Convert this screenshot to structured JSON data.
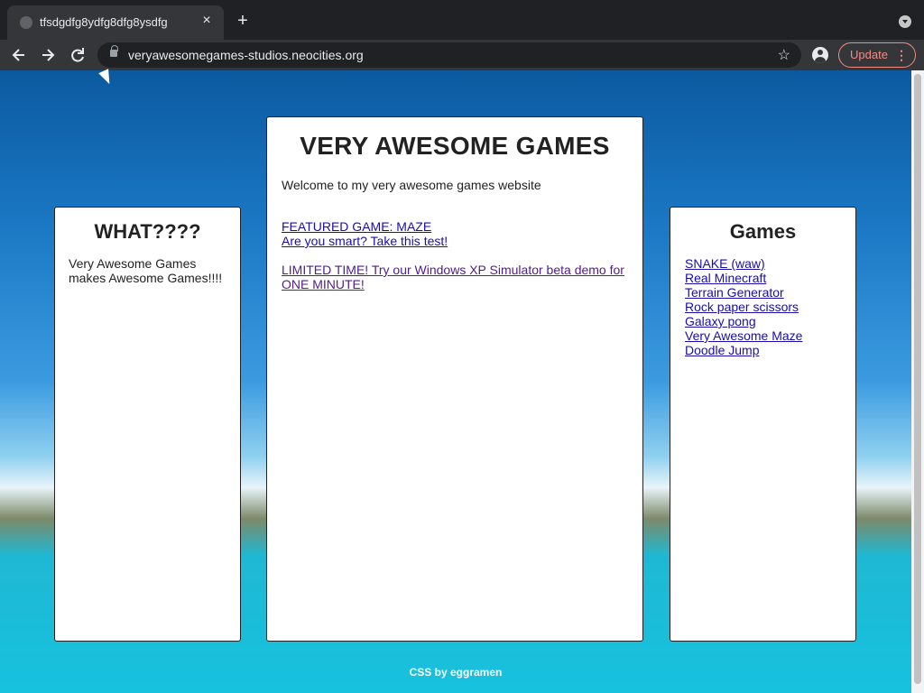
{
  "browser": {
    "tab": {
      "title": "tfsdgdfg8ydfg8dfg8ysdfg",
      "close_icon": "×"
    },
    "new_tab_icon": "+",
    "url": "veryawesomegames-studios.neocities.org",
    "update_label": "Update",
    "update_menu": "⋮"
  },
  "page": {
    "left": {
      "title": "WHAT????",
      "text": "Very Awesome Games makes Awesome Games!!!!"
    },
    "center": {
      "title": "VERY AWESOME GAMES",
      "welcome": "Welcome to my very awesome games website",
      "featured_link": "FEATURED GAME: MAZE",
      "test_link": "Are you smart? Take this test!",
      "xp_link": "LIMITED TIME! Try our Windows XP Simulator beta demo for ONE MINUTE!"
    },
    "right": {
      "title": "Games",
      "games": [
        "SNAKE (waw)",
        "Real Minecraft",
        "Terrain Generator",
        "Rock paper scissors",
        "Galaxy pong",
        "Very Awesome Maze",
        "Doodle Jump"
      ]
    },
    "footer": "CSS by eggramen"
  }
}
